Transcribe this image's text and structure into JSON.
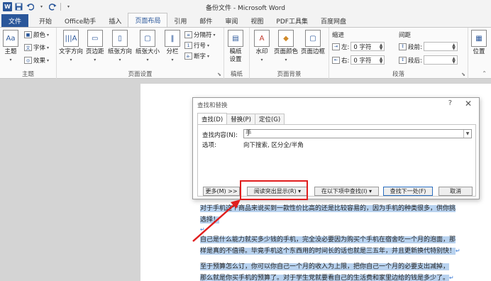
{
  "window": {
    "title": "备份文件 - Microsoft Word"
  },
  "qat": {
    "logo": "W",
    "save_icon": "save-icon",
    "undo_icon": "undo-icon",
    "redo_icon": "redo-icon"
  },
  "tabs": [
    {
      "label": "文件"
    },
    {
      "label": "开始"
    },
    {
      "label": "Office助手"
    },
    {
      "label": "插入"
    },
    {
      "label": "页面布局"
    },
    {
      "label": "引用"
    },
    {
      "label": "邮件"
    },
    {
      "label": "审阅"
    },
    {
      "label": "视图"
    },
    {
      "label": "PDF工具集"
    },
    {
      "label": "百度网盘"
    }
  ],
  "ribbon": {
    "theme": {
      "main": "主题",
      "colors": "颜色",
      "fonts": "字体",
      "effects": "效果",
      "group": "主题"
    },
    "page_setup": {
      "text_dir": "文字方向",
      "margins": "页边距",
      "orientation": "纸张方向",
      "size": "纸张大小",
      "columns": "分栏",
      "breaks": "分隔符",
      "line_numbers": "行号",
      "hyphenation": "断字",
      "group": "页面设置"
    },
    "manuscript": {
      "label1": "稿纸",
      "label2": "设置",
      "group": "稿纸"
    },
    "background": {
      "watermark": "水印",
      "page_color": "页面颜色",
      "page_border": "页面边框",
      "group": "页面背景"
    },
    "paragraph": {
      "indent": "缩进",
      "spacing": "间距",
      "left_label": "左:",
      "left_value": "0 字符",
      "right_label": "右:",
      "right_value": "0 字符",
      "before_label": "段前:",
      "before_value": "",
      "after_label": "段后:",
      "after_value": "",
      "group": "段落"
    },
    "arrange": {
      "position": "位置"
    }
  },
  "document": {
    "para1_line1": "对于手机这个商品来说买到一款性价比高的还是比较容易的，因为手机的种类很多，供你挑",
    "para1_line2": "选择！",
    "para2_line1": "自己是什么能力就买多少钱的手机，完全没必要因为购买个手机在宿舍吃一个月的泡面，那",
    "para2_line2": "样是真的不值得。毕竟手机这个东西用的时间长的话也就是三五年，并且更新换代特别快！",
    "para3_line1": "至于预算怎么订，你可以你自己一个月的收入为上限，把你自己一个月的必要支出减掉，",
    "para3_line2": "那么就是你买手机的预算了。对于学生党就要看自己的生活费和家里边给的钱是多少了。",
    "para_mark": "↵"
  },
  "dialog": {
    "title": "查找和替换",
    "help": "?",
    "close": "✕",
    "tabs": [
      {
        "label": "查找(D)"
      },
      {
        "label": "替换(P)"
      },
      {
        "label": "定位(G)"
      }
    ],
    "find_label": "查找内容(N):",
    "find_value": "手",
    "options_label": "选项:",
    "options_value": "向下搜索, 区分全/半角",
    "buttons": {
      "more": "更多(M) >>",
      "reading_highlight": "阅读突出显示(R) ▾",
      "find_in": "在以下项中查找(I) ▾",
      "find_next": "查找下一处(F)",
      "cancel": "取消"
    }
  },
  "colors": {
    "accent": "#2b579a",
    "highlight": "#b8d2ef",
    "annotation": "#e01e1e"
  }
}
